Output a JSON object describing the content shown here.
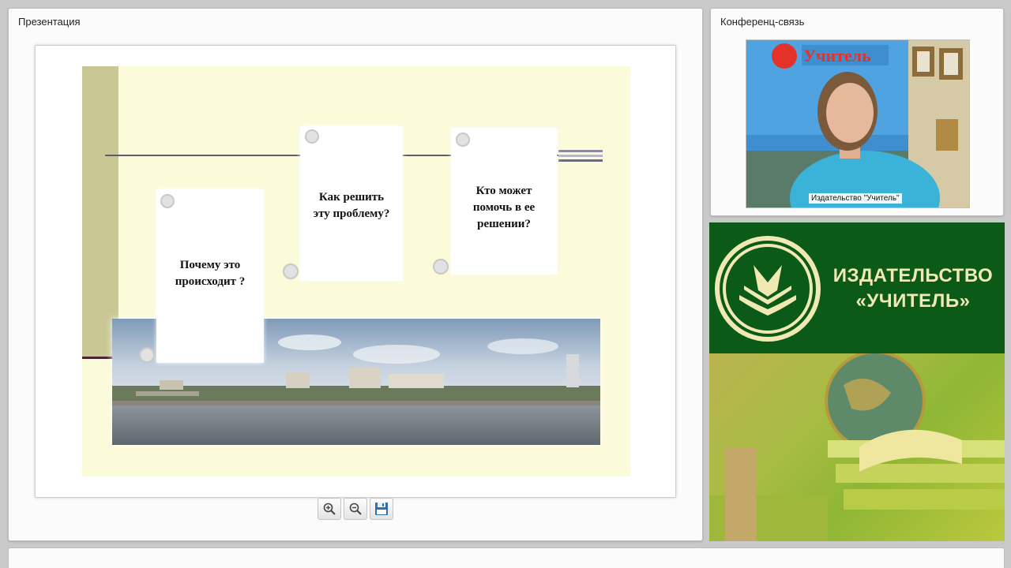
{
  "presentation_panel": {
    "title": "Презентация",
    "slide": {
      "cards": [
        {
          "text": "Почему это происходит ?"
        },
        {
          "text": "Как решить эту проблему?"
        },
        {
          "text": "Кто может помочь в ее решении?"
        }
      ]
    },
    "toolbar": {
      "zoom_in_icon": "zoom-in-icon",
      "zoom_out_icon": "zoom-out-icon",
      "save_icon": "floppy-disk-icon"
    }
  },
  "conference_panel": {
    "title": "Конференц-связь",
    "video": {
      "caption": "Издательство \"Учитель\"",
      "banner_text": "Учитель"
    }
  },
  "publisher_banner": {
    "line1": "ИЗДАТЕЛЬСТВО",
    "line2": "«УЧИТЕЛЬ»",
    "colors": {
      "green": "#0b5a18",
      "gold": "#f1e9b3"
    }
  }
}
